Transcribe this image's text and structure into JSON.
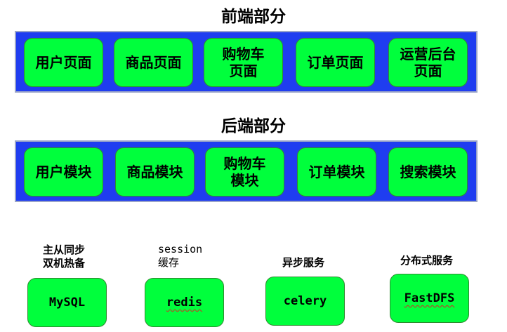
{
  "frontend": {
    "title": "前端部分",
    "items": [
      "用户页面",
      "商品页面",
      "购物车\n页面",
      "订单页面",
      "运营后台\n页面"
    ]
  },
  "backend": {
    "title": "后端部分",
    "items": [
      "用户模块",
      "商品模块",
      "购物车\n模块",
      "订单模块",
      "搜索模块"
    ]
  },
  "services": [
    {
      "label": "主从同步\n双机热备",
      "name": "MySQL"
    },
    {
      "label": "session\n缓存",
      "name": "redis"
    },
    {
      "label": "异步服务",
      "name": "celery"
    },
    {
      "label": "分布式服务",
      "name": "FastDFS"
    }
  ],
  "colors": {
    "band": "#1f3df0",
    "box": "#00ff3c"
  }
}
